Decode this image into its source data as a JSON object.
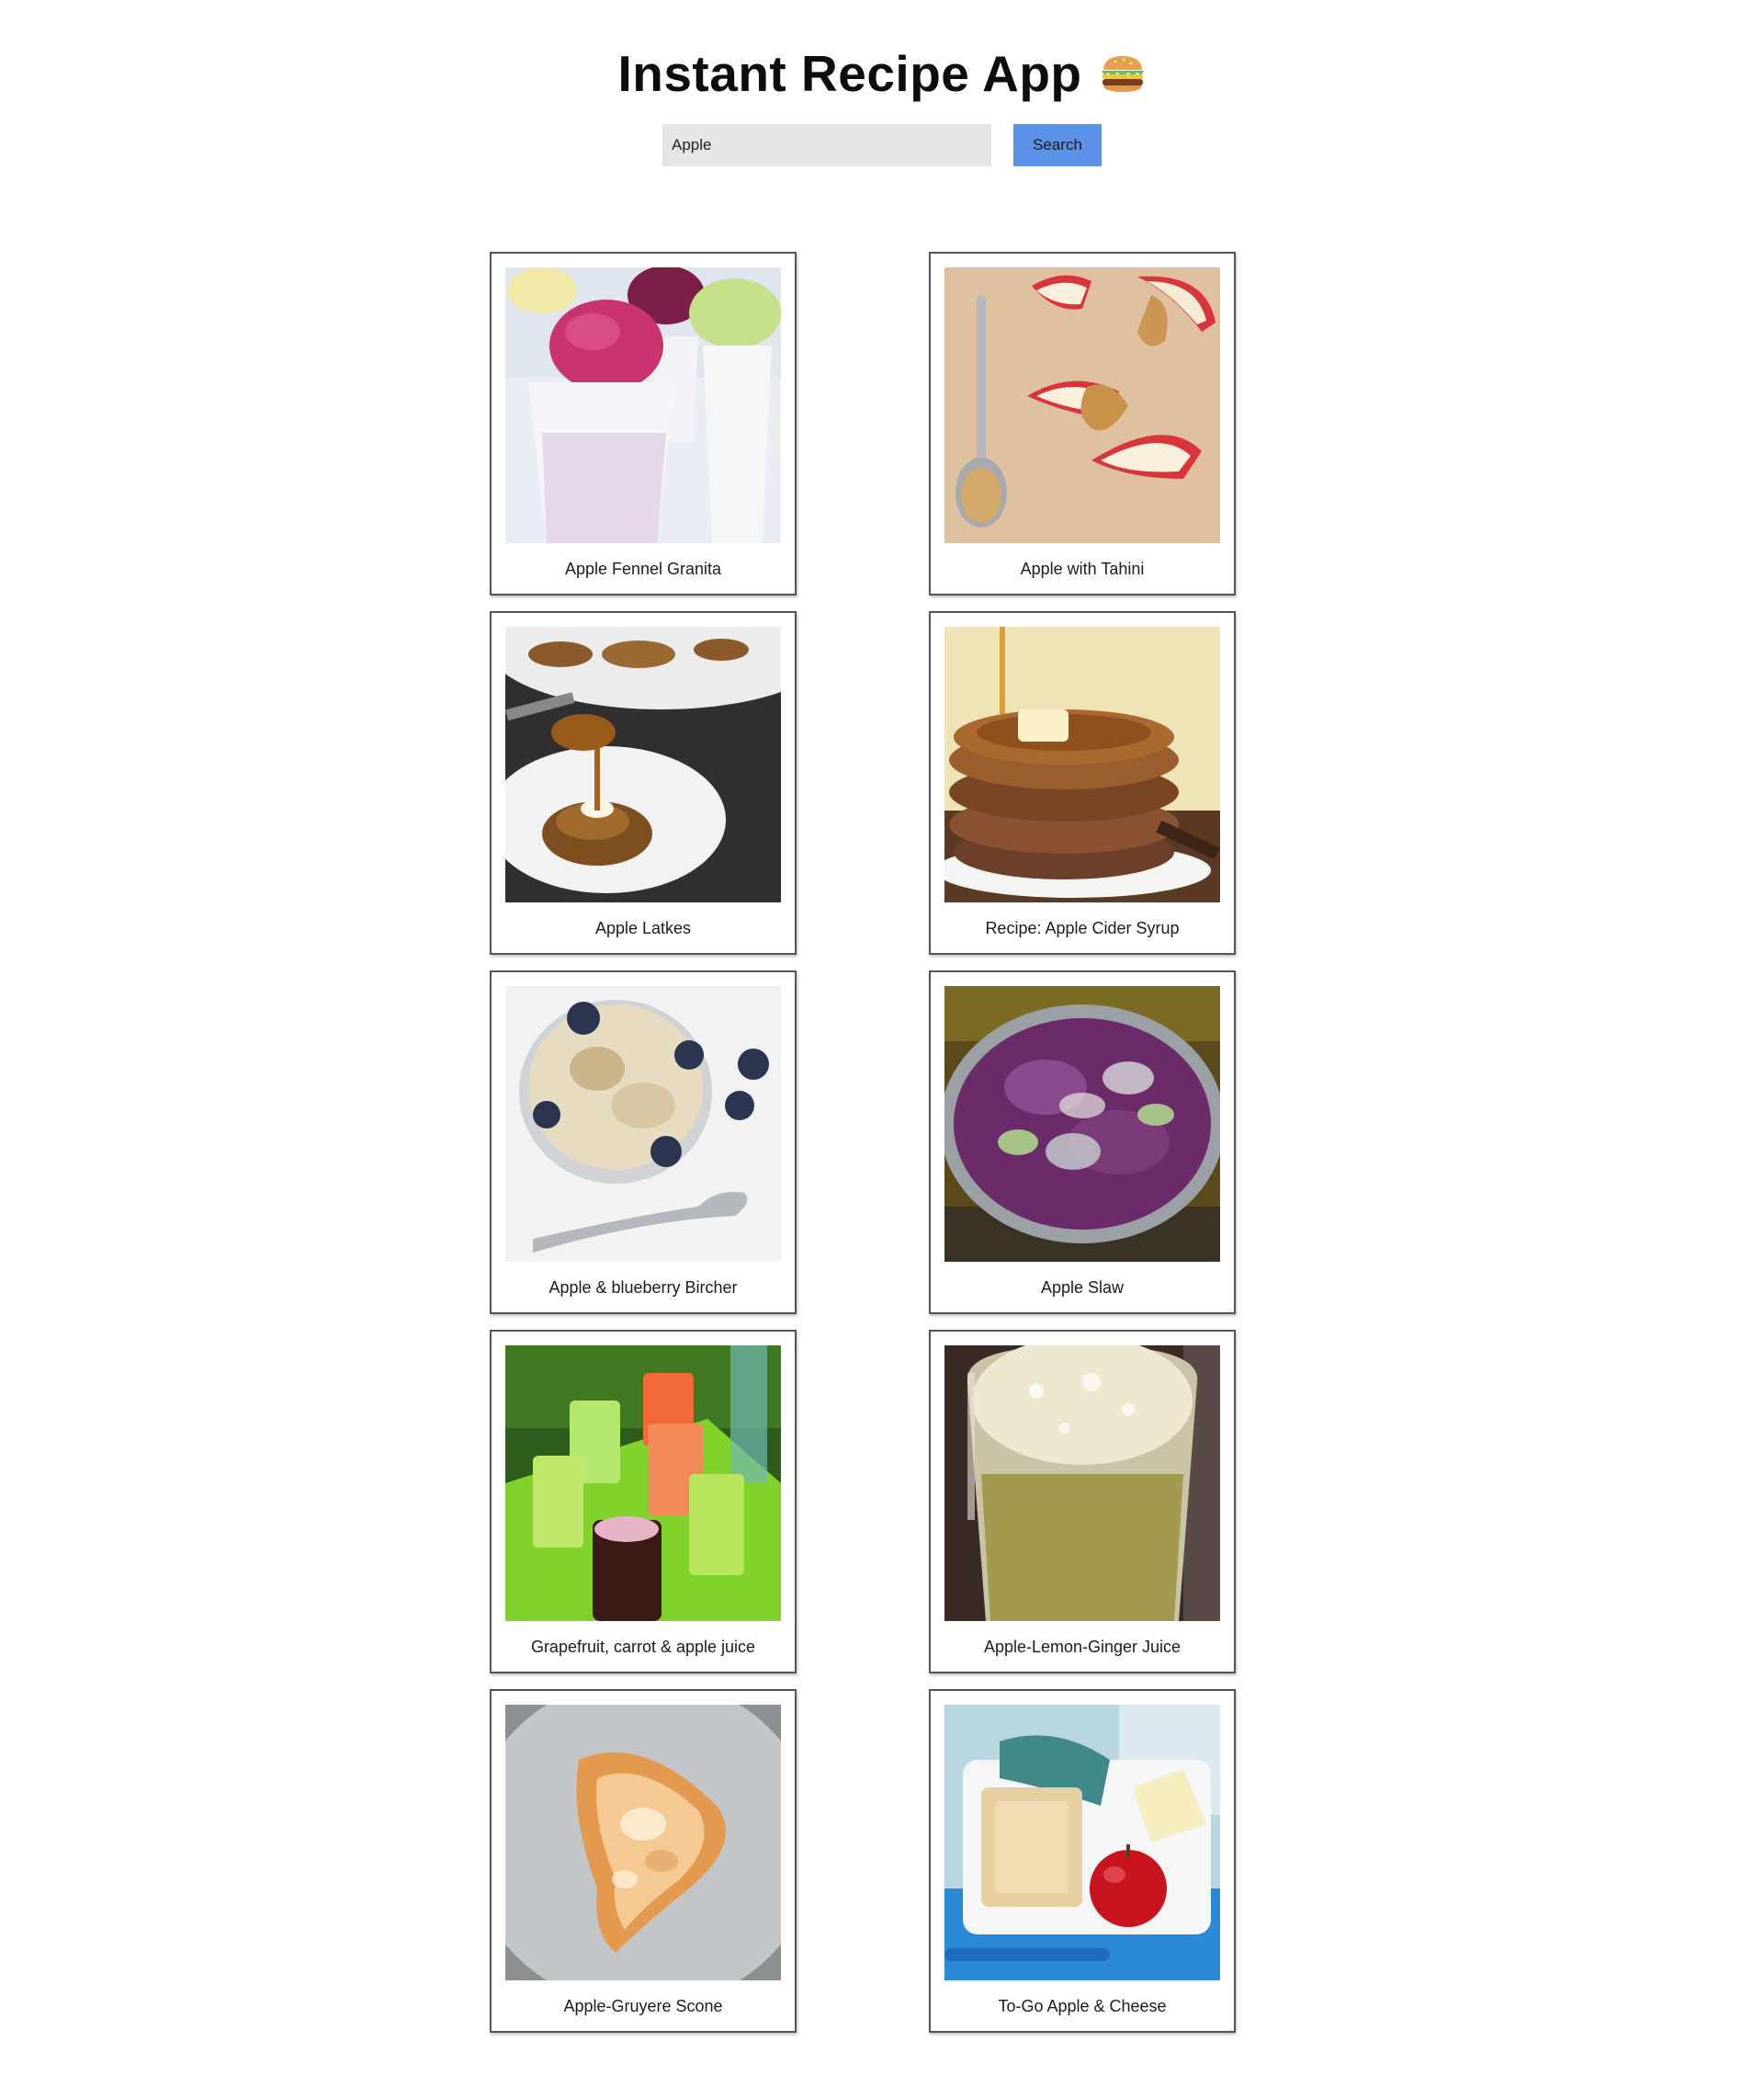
{
  "app": {
    "title": "Instant Recipe App",
    "title_icon": "hamburger-icon"
  },
  "search": {
    "value": "Apple",
    "button_label": "Search"
  },
  "colors": {
    "search_button": "#5b92e8",
    "search_input_bg": "#e6e6e6",
    "card_border": "#555555"
  },
  "recipes": [
    {
      "label": "Apple Fennel Granita",
      "image": "granita-cups-photo"
    },
    {
      "label": "Apple with Tahini",
      "image": "apple-slices-tahini-photo"
    },
    {
      "label": "Apple Latkes",
      "image": "latke-caramel-photo"
    },
    {
      "label": "Recipe: Apple Cider Syrup",
      "image": "pancake-stack-syrup-photo"
    },
    {
      "label": "Apple & blueberry Bircher",
      "image": "bircher-blueberry-glass-photo"
    },
    {
      "label": "Apple Slaw",
      "image": "purple-slaw-bowl-photo"
    },
    {
      "label": "Grapefruit, carrot & apple juice",
      "image": "juice-glasses-tray-photo"
    },
    {
      "label": "Apple-Lemon-Ginger Juice",
      "image": "juice-jar-photo"
    },
    {
      "label": "Apple-Gruyere Scone",
      "image": "scone-plate-photo"
    },
    {
      "label": "To-Go Apple & Cheese",
      "image": "lunchbox-apple-photo"
    }
  ]
}
